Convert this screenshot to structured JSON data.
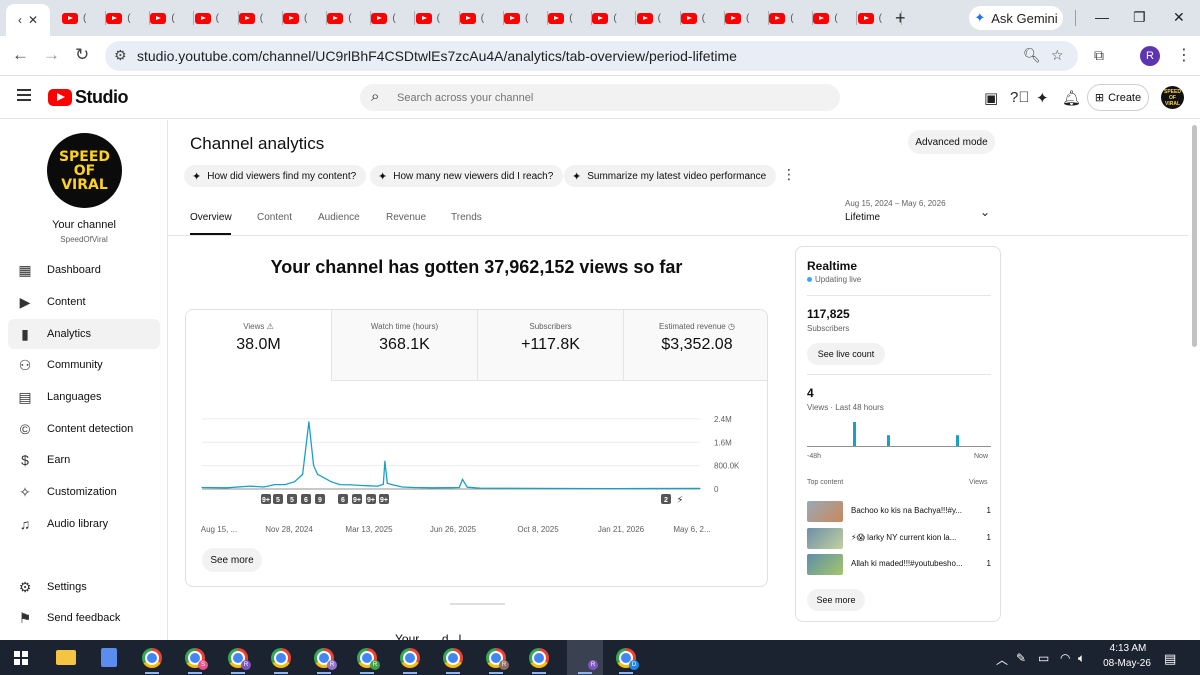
{
  "browser": {
    "url": "studio.youtube.com/channel/UC9rlBhF4CSDtwlEs7zcAu4A/analytics/tab-overview/period-lifetime",
    "ask_gemini": "Ask Gemini",
    "profile_initial": "R",
    "new_tab": "+"
  },
  "header": {
    "logo_text": "Studio",
    "search_placeholder": "Search across your channel",
    "create_label": "Create"
  },
  "sidebar": {
    "avatar_lines": [
      "SPEED",
      "OF",
      "VIRAL"
    ],
    "channel_title": "Your channel",
    "channel_name": "SpeedOfViral",
    "items": [
      {
        "label": "Dashboard",
        "icon": "dashboard-icon"
      },
      {
        "label": "Content",
        "icon": "content-icon"
      },
      {
        "label": "Analytics",
        "icon": "analytics-icon",
        "active": true
      },
      {
        "label": "Community",
        "icon": "community-icon"
      },
      {
        "label": "Languages",
        "icon": "languages-icon"
      },
      {
        "label": "Content detection",
        "icon": "copyright-icon"
      },
      {
        "label": "Earn",
        "icon": "dollar-icon"
      },
      {
        "label": "Customization",
        "icon": "wand-icon"
      },
      {
        "label": "Audio library",
        "icon": "audio-library-icon"
      },
      {
        "label": "Settings",
        "icon": "gear-icon"
      },
      {
        "label": "Send feedback",
        "icon": "feedback-icon"
      }
    ]
  },
  "main": {
    "title": "Channel analytics",
    "advanced_mode": "Advanced mode",
    "chips": [
      "How did viewers find my content?",
      "How many new viewers did I reach?",
      "Summarize my latest video performance"
    ],
    "tabs": [
      "Overview",
      "Content",
      "Audience",
      "Revenue",
      "Trends"
    ],
    "date_range": "Aug 15, 2024 – May 6, 2026",
    "date_label": "Lifetime",
    "headline": "Your channel has gotten 37,962,152 views so far",
    "metrics": [
      {
        "label": "Views",
        "value": "38.0M"
      },
      {
        "label": "Watch time (hours)",
        "value": "368.1K"
      },
      {
        "label": "Subscribers",
        "value": "+117.8K"
      },
      {
        "label": "Estimated revenue",
        "value": "$3,352.08"
      }
    ],
    "see_more": "See more",
    "below_fold_text": "Your...  ...d...l..."
  },
  "chart_data": {
    "type": "line",
    "series": [
      {
        "name": "Views",
        "x": [
          "Aug 15, 2024",
          "Sep 15, 2024",
          "Oct 15, 2024",
          "Nov 1, 2024",
          "Nov 15, 2024",
          "Nov 28, 2024",
          "Dec 10, 2024",
          "Dec 20, 2024",
          "Dec 28, 2024",
          "Jan 3, 2025",
          "Jan 8, 2025",
          "Jan 15, 2025",
          "Jan 25, 2025",
          "Feb 5, 2025",
          "Feb 20, 2025",
          "Mar 5, 2025",
          "Mar 13, 2025",
          "Mar 25, 2025",
          "Apr 1, 2025",
          "Apr 3, 2025",
          "Apr 6, 2025",
          "Apr 12, 2025",
          "Apr 25, 2025",
          "May 10, 2025",
          "Jun 1, 2025",
          "Jun 26, 2025",
          "Jul 6, 2025",
          "Jul 10, 2025",
          "Jul 16, 2025",
          "Aug 1, 2025",
          "Oct 8, 2025",
          "Jan 21, 2026",
          "May 6, 2026"
        ],
        "values": [
          50000,
          40000,
          100000,
          70000,
          150000,
          150000,
          250000,
          500000,
          2300000,
          800000,
          500000,
          400000,
          250000,
          150000,
          140000,
          120000,
          110000,
          100000,
          160000,
          950000,
          200000,
          150000,
          70000,
          50000,
          40000,
          45000,
          50000,
          330000,
          60000,
          30000,
          20000,
          15000,
          20000
        ]
      }
    ],
    "yticks": [
      "2.4M",
      "1.6M",
      "800.0K",
      "0"
    ],
    "ylim": [
      0,
      2500000
    ],
    "xticks": [
      "Aug 15, ...",
      "Nov 28, 2024",
      "Mar 13, 2025",
      "Jun 26, 2025",
      "Oct 8, 2025",
      "Jan 21, 2026",
      "May 6, 2..."
    ],
    "markers": [
      "9+",
      "5",
      "5",
      "6",
      "9",
      "6",
      "9+",
      "9+",
      "9+",
      "2"
    ],
    "color": "#1aa0c8",
    "grid": true
  },
  "realtime": {
    "title": "Realtime",
    "status": "Updating live",
    "subscribers_value": "117,825",
    "subscribers_label": "Subscribers",
    "see_live_count": "See live count",
    "views_value": "4",
    "views_label": "Views · Last 48 hours",
    "bars": [
      1,
      0.45,
      0.45
    ],
    "axis_left": "-48h",
    "axis_right": "Now",
    "top_content_label": "Top content",
    "views_col": "Views",
    "top_content": [
      {
        "title": "Bachoo ko kis na Bachya!!!#y...",
        "views": "1"
      },
      {
        "title": "⚡😱 larky NY current kion la...",
        "views": "1"
      },
      {
        "title": "Allah ki maded!!!#youtubesho...",
        "views": "1"
      }
    ],
    "see_more": "See more"
  },
  "taskbar": {
    "time": "4:13 AM",
    "date": "08-May-26"
  }
}
